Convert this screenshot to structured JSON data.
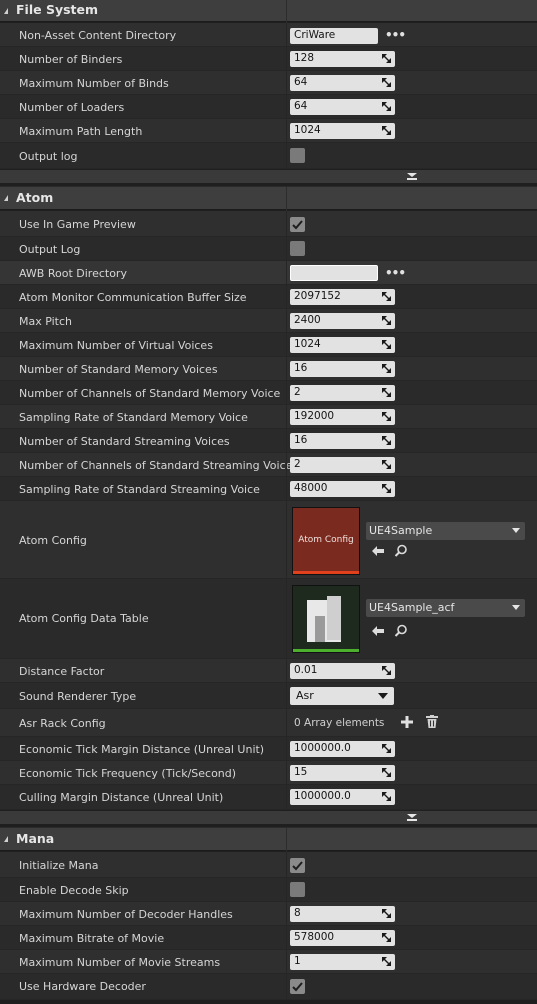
{
  "file_system": {
    "title": "File System",
    "non_asset_dir_label": "Non-Asset Content Directory",
    "non_asset_dir_value": "CriWare",
    "num_binders_label": "Number of Binders",
    "num_binders_value": "128",
    "max_binds_label": "Maximum Number of Binds",
    "max_binds_value": "64",
    "num_loaders_label": "Number of Loaders",
    "num_loaders_value": "64",
    "max_path_label": "Maximum Path Length",
    "max_path_value": "1024",
    "output_log_label": "Output log",
    "output_log_checked": false
  },
  "atom": {
    "title": "Atom",
    "use_in_game_preview_label": "Use In Game Preview",
    "use_in_game_preview_checked": true,
    "output_log_label": "Output Log",
    "output_log_checked": false,
    "awb_root_label": "AWB Root Directory",
    "awb_root_value": "",
    "monitor_buffer_label": "Atom Monitor Communication Buffer Size",
    "monitor_buffer_value": "2097152",
    "max_pitch_label": "Max Pitch",
    "max_pitch_value": "2400",
    "max_virtual_voices_label": "Maximum Number of Virtual Voices",
    "max_virtual_voices_value": "1024",
    "num_std_memory_voices_label": "Number of Standard Memory Voices",
    "num_std_memory_voices_value": "16",
    "channels_std_memory_label": "Number of Channels of Standard Memory Voice",
    "channels_std_memory_value": "2",
    "sampling_std_memory_label": "Sampling Rate of Standard Memory Voice",
    "sampling_std_memory_value": "192000",
    "num_std_streaming_label": "Number of Standard Streaming Voices",
    "num_std_streaming_value": "16",
    "channels_std_streaming_label": "Number of Channels of Standard Streaming Voice",
    "channels_std_streaming_value": "2",
    "sampling_std_streaming_label": "Sampling Rate of Standard Streaming Voice",
    "sampling_std_streaming_value": "48000",
    "atom_config_label": "Atom Config",
    "atom_config_thumb_text": "Atom Config",
    "atom_config_value": "UE4Sample",
    "atom_config_data_table_label": "Atom Config Data Table",
    "atom_config_data_table_value": "UE4Sample_acf",
    "distance_factor_label": "Distance Factor",
    "distance_factor_value": "0.01",
    "sound_renderer_label": "Sound Renderer Type",
    "sound_renderer_value": "Asr",
    "asr_rack_label": "Asr Rack Config",
    "asr_rack_value": "0 Array elements",
    "econ_tick_margin_label": "Economic Tick Margin Distance (Unreal Unit)",
    "econ_tick_margin_value": "1000000.0",
    "econ_tick_freq_label": "Economic Tick Frequency (Tick/Second)",
    "econ_tick_freq_value": "15",
    "culling_margin_label": "Culling Margin Distance (Unreal Unit)",
    "culling_margin_value": "1000000.0"
  },
  "mana": {
    "title": "Mana",
    "initialize_label": "Initialize Mana",
    "initialize_checked": true,
    "decode_skip_label": "Enable Decode Skip",
    "decode_skip_checked": false,
    "max_decoder_handles_label": "Maximum Number of Decoder Handles",
    "max_decoder_handles_value": "8",
    "max_bitrate_label": "Maximum Bitrate of Movie",
    "max_bitrate_value": "578000",
    "max_movie_streams_label": "Maximum Number of Movie Streams",
    "max_movie_streams_value": "1",
    "hw_decoder_label": "Use Hardware Decoder",
    "hw_decoder_checked": true
  },
  "colors": {
    "panel_bg": "#2f2f2f",
    "header_bg": "#3e3e3e",
    "field_bg": "#e2e2e2",
    "atom_config_thumb": "#7a2a1e",
    "atom_config_bar": "#e0401c",
    "data_table_thumb": "#1d2a1d",
    "data_table_bar": "#4caf2e"
  },
  "icons": {
    "spin": "spin-arrows-icon",
    "browse": "ellipsis-icon",
    "use_selected": "arrow-left-icon",
    "find": "magnifier-icon",
    "add": "plus-icon",
    "delete": "trash-icon",
    "check": "checkmark-icon",
    "collapse": "double-chevron-down-icon"
  }
}
